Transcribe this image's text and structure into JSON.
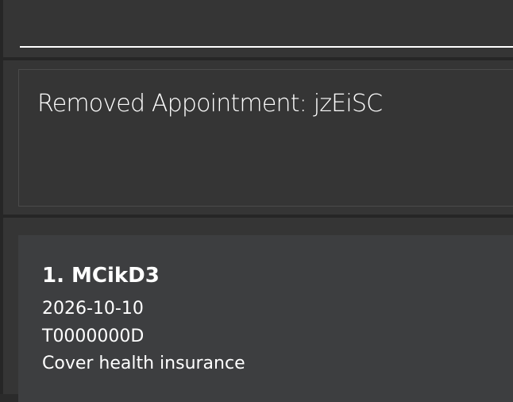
{
  "command_box": {
    "value": ""
  },
  "result_display": {
    "text": "Removed Appointment: jzEiSC"
  },
  "appointment_list": {
    "items": [
      {
        "index": "1.",
        "name": "MCikD3",
        "title": "1. MCikD3",
        "date": "2026-10-10",
        "nric": "T0000000D",
        "description": "Cover health insurance"
      }
    ]
  },
  "colors": {
    "background": "#2b2b2b",
    "panel": "#353535",
    "card": "#3d3e40",
    "text": "#ffffff"
  }
}
